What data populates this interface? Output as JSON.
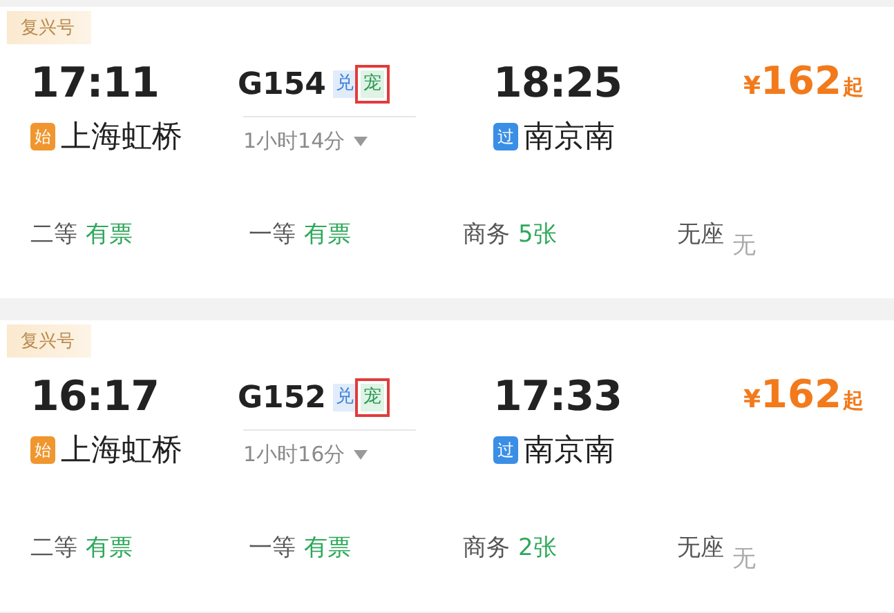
{
  "trains": [
    {
      "type_tag": "复兴号",
      "depart_time": "17:11",
      "train_no": "G154",
      "badges": [
        {
          "text": "兑",
          "kind": "exchange",
          "highlighted": false
        },
        {
          "text": "宠",
          "kind": "pet",
          "highlighted": true
        }
      ],
      "arrive_time": "18:25",
      "price_symbol": "¥",
      "price": "162",
      "price_suffix": "起",
      "from_mark": "始",
      "from_station": "上海虹桥",
      "duration": "1小时14分",
      "to_mark": "过",
      "to_station": "南京南",
      "seats": [
        {
          "class": "二等",
          "availability": "有票",
          "available": true
        },
        {
          "class": "一等",
          "availability": "有票",
          "available": true
        },
        {
          "class": "商务",
          "availability": "5张",
          "available": true
        },
        {
          "class": "无座",
          "availability": "无",
          "available": false
        }
      ]
    },
    {
      "type_tag": "复兴号",
      "depart_time": "16:17",
      "train_no": "G152",
      "badges": [
        {
          "text": "兑",
          "kind": "exchange",
          "highlighted": false
        },
        {
          "text": "宠",
          "kind": "pet",
          "highlighted": true
        }
      ],
      "arrive_time": "17:33",
      "price_symbol": "¥",
      "price": "162",
      "price_suffix": "起",
      "from_mark": "始",
      "from_station": "上海虹桥",
      "duration": "1小时16分",
      "to_mark": "过",
      "to_station": "南京南",
      "seats": [
        {
          "class": "二等",
          "availability": "有票",
          "available": true
        },
        {
          "class": "一等",
          "availability": "有票",
          "available": true
        },
        {
          "class": "商务",
          "availability": "2张",
          "available": true
        },
        {
          "class": "无座",
          "availability": "无",
          "available": false
        }
      ]
    }
  ]
}
